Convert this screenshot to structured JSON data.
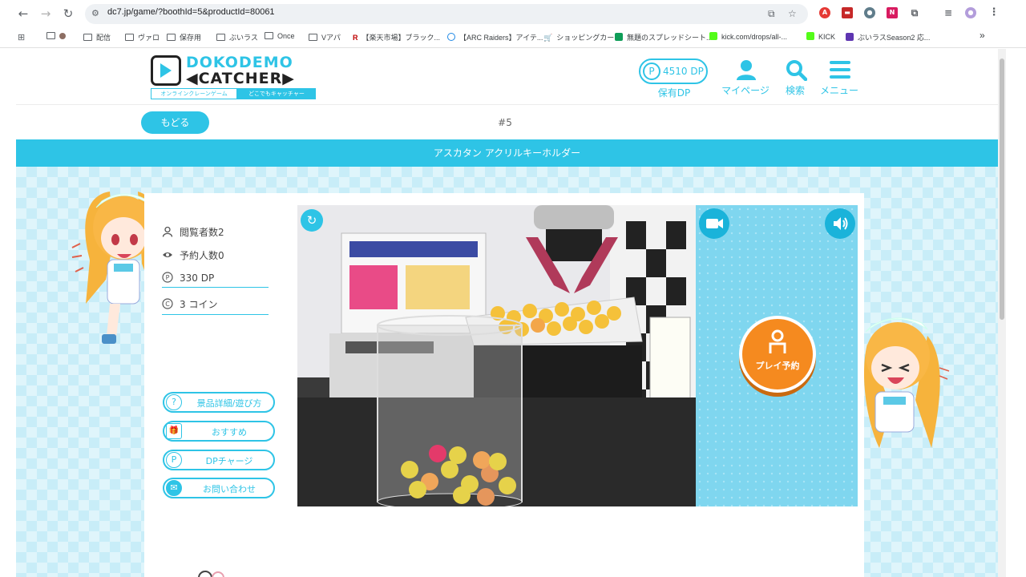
{
  "browser": {
    "url": "dc7.jp/game/?boothId=5&productId=80061",
    "bookmarks": [
      "配信",
      "ヴァロ",
      "保存用",
      "ぶいラス",
      "Once",
      "Vアパ",
      "【楽天市場】ブラック...",
      "【ARC Raiders】アイテ...",
      "ショッピングカート",
      "無題のスプレッドシート...",
      "kick.com/drops/all-...",
      "KICK",
      "ぶいラスSeason2 応..."
    ],
    "more_label": "»"
  },
  "header": {
    "logo_line1": "DOKODEMO",
    "logo_line2": "◀CATCHER▶",
    "logo_sub_left": "オンラインクレーンゲーム",
    "logo_sub_right": "どこでもキャッチャー",
    "dp_value": "4510 DP",
    "dp_label": "保有DP",
    "mypage_label": "マイページ",
    "search_label": "検索",
    "menu_label": "メニュー"
  },
  "subheader": {
    "back_label": "もどる",
    "booth_number": "#5"
  },
  "product_title": "アスカタン アクリルキーホルダー",
  "stats": {
    "viewers": "閲覧者数2",
    "reservations": "予約人数0",
    "dp_cost": "330 DP",
    "coin_cost": "3 コイン"
  },
  "side_buttons": [
    {
      "label": "景品詳細/遊び方",
      "icon": "?"
    },
    {
      "label": "おすすめ",
      "icon": "🎁"
    },
    {
      "label": "DPチャージ",
      "icon": "P"
    },
    {
      "label": "お問い合わせ",
      "icon": "✉"
    }
  ],
  "controls": {
    "play_reserve_label": "プレイ予約"
  },
  "colors": {
    "accent": "#2ec4e6",
    "play_button": "#f58a1f"
  }
}
